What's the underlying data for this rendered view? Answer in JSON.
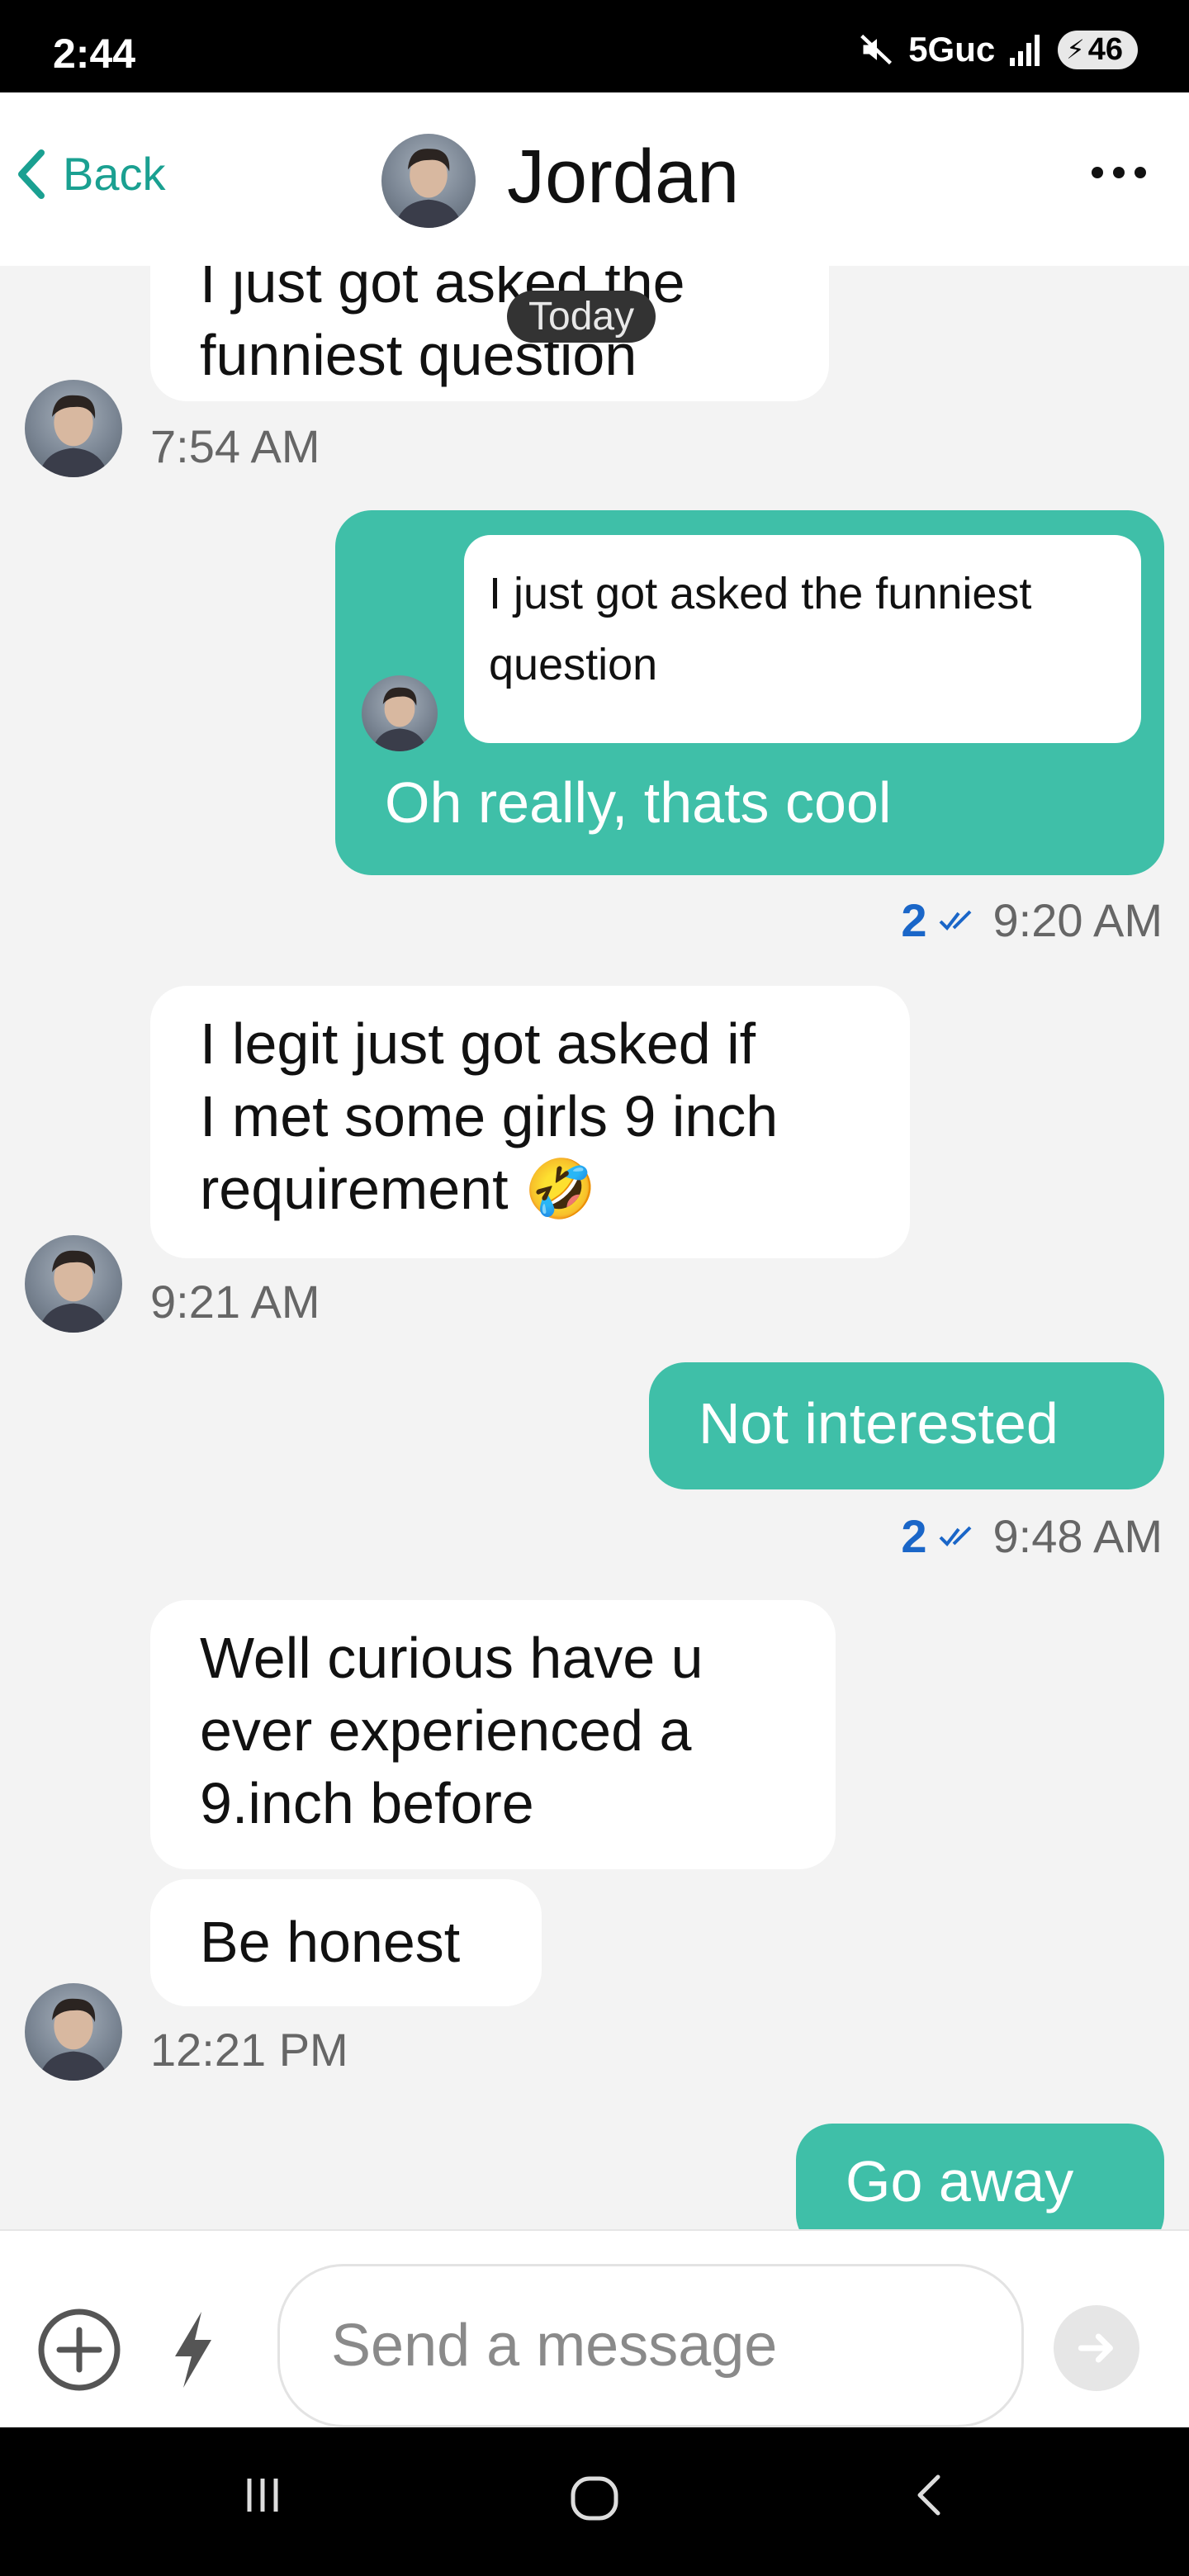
{
  "status_bar": {
    "time": "2:44",
    "network": "5Guc",
    "battery": "46"
  },
  "header": {
    "back_label": "Back",
    "contact_name": "Jordan"
  },
  "chat": {
    "date_divider": "Today",
    "messages": [
      {
        "direction": "incoming",
        "text_line1": "I just got asked the",
        "text_line2": "funniest question",
        "time": "7:54 AM"
      },
      {
        "direction": "outgoing",
        "quoted_text_line1": "I just got asked the funniest",
        "quoted_text_line2": "question",
        "text": "Oh really, thats cool",
        "read_count": "2",
        "time": "9:20 AM"
      },
      {
        "direction": "incoming",
        "text_line1": "I legit just got asked if",
        "text_line2": "I met some girls 9 inch",
        "text_line3": "requirement",
        "emoji": "🤣",
        "time": "9:21 AM"
      },
      {
        "direction": "outgoing",
        "text": "Not interested",
        "read_count": "2",
        "time": "9:48 AM"
      },
      {
        "direction": "incoming",
        "text_line1": "Well curious have u",
        "text_line2": "ever experienced a",
        "text_line3": "9.inch before"
      },
      {
        "direction": "incoming",
        "text": "Be honest",
        "time": "12:21 PM"
      },
      {
        "direction": "outgoing",
        "text": "Go away"
      }
    ]
  },
  "composer": {
    "placeholder": "Send a message"
  },
  "colors": {
    "accent": "#1aa091",
    "outgoing_bubble": "#3fbfa8",
    "read_receipt": "#1a66c8"
  },
  "icons": {
    "back": "chevron-left-icon",
    "more": "more-horizontal-icon",
    "add": "plus-circle-icon",
    "quick": "lightning-icon",
    "send": "arrow-right-icon"
  }
}
